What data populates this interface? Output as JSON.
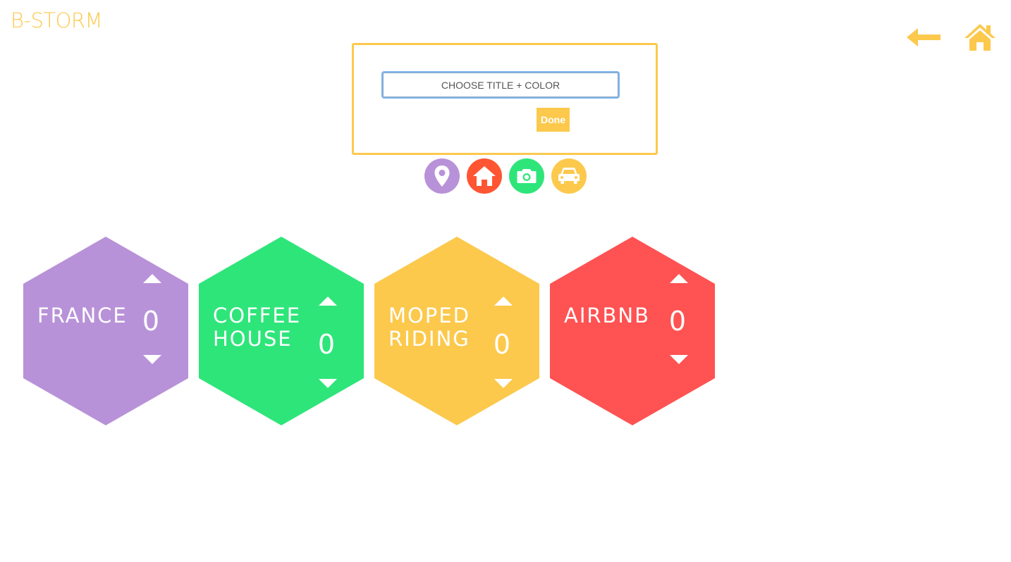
{
  "app": {
    "logo": "B-STORM"
  },
  "nav": {
    "back_icon": "arrow-left-icon",
    "home_icon": "home-icon",
    "color": "#fcc94d"
  },
  "modal": {
    "input_value": "CHOOSE TITLE + COLOR",
    "done_label": "Done"
  },
  "color_options": [
    {
      "name": "location",
      "icon": "map-pin-icon",
      "color": "#b892d8"
    },
    {
      "name": "home",
      "icon": "home-icon",
      "color": "#ff5533"
    },
    {
      "name": "camera",
      "icon": "camera-icon",
      "color": "#2ee57a"
    },
    {
      "name": "car",
      "icon": "car-icon",
      "color": "#fcc94d"
    }
  ],
  "ideas": [
    {
      "title_lines": [
        "FRANCE"
      ],
      "count": "0",
      "color": "#b892d8"
    },
    {
      "title_lines": [
        "COFFEE",
        "HOUSE"
      ],
      "count": "0",
      "color": "#2ee57a"
    },
    {
      "title_lines": [
        "MOPED",
        "RIDING"
      ],
      "count": "0",
      "color": "#fcc94d"
    },
    {
      "title_lines": [
        "AIRBNB"
      ],
      "count": "0",
      "color": "#ff5252"
    }
  ]
}
